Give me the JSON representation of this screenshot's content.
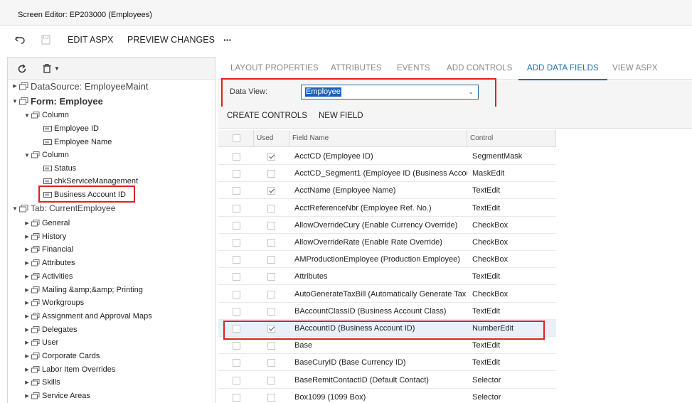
{
  "window": {
    "title": "Screen Editor: EP203000 (Employees)"
  },
  "toolbar": {
    "edit_aspx": "EDIT ASPX",
    "preview_changes": "PREVIEW CHANGES",
    "more": "···"
  },
  "tree": {
    "items": [
      {
        "label": "DataSource: EmployeeMaint",
        "level": 0,
        "expanded": false
      },
      {
        "label": "Form: Employee",
        "level": 0,
        "expanded": true,
        "bold": true
      },
      {
        "label": "Column",
        "level": 1,
        "expanded": true
      },
      {
        "label": "Employee ID",
        "level": 2
      },
      {
        "label": "Employee Name",
        "level": 2
      },
      {
        "label": "Column",
        "level": 1,
        "expanded": true
      },
      {
        "label": "Status",
        "level": 2
      },
      {
        "label": "chkServiceManagement",
        "level": 2
      },
      {
        "label": "Business Account ID",
        "level": 2,
        "highlighted": true
      },
      {
        "label": "Tab: CurrentEmployee",
        "level": 0,
        "expanded": true
      },
      {
        "label": "General",
        "level": 1,
        "expanded": false
      },
      {
        "label": "History",
        "level": 1,
        "expanded": false
      },
      {
        "label": "Financial",
        "level": 1,
        "expanded": false
      },
      {
        "label": "Attributes",
        "level": 1,
        "expanded": false
      },
      {
        "label": "Activities",
        "level": 1,
        "expanded": false
      },
      {
        "label": "Mailing &amp;&amp; Printing",
        "level": 1,
        "expanded": false
      },
      {
        "label": "Workgroups",
        "level": 1,
        "expanded": false
      },
      {
        "label": "Assignment and Approval Maps",
        "level": 1,
        "expanded": false
      },
      {
        "label": "Delegates",
        "level": 1,
        "expanded": false
      },
      {
        "label": "User",
        "level": 1,
        "expanded": false
      },
      {
        "label": "Corporate Cards",
        "level": 1,
        "expanded": false
      },
      {
        "label": "Labor Item Overrides",
        "level": 1,
        "expanded": false
      },
      {
        "label": "Skills",
        "level": 1,
        "expanded": false
      },
      {
        "label": "Service Areas",
        "level": 1,
        "expanded": false
      }
    ]
  },
  "tabs": [
    {
      "label": "LAYOUT PROPERTIES",
      "active": false
    },
    {
      "label": "ATTRIBUTES",
      "active": false
    },
    {
      "label": "EVENTS",
      "active": false
    },
    {
      "label": "ADD CONTROLS",
      "active": false
    },
    {
      "label": "ADD DATA FIELDS",
      "active": true
    },
    {
      "label": "VIEW ASPX",
      "active": false
    }
  ],
  "data_view": {
    "label": "Data View:",
    "value": "Employee"
  },
  "grid_toolbar": {
    "create_controls": "CREATE CONTROLS",
    "new_field": "NEW FIELD"
  },
  "grid": {
    "columns": {
      "used": "Used",
      "field_name": "Field Name",
      "control": "Control"
    },
    "rows": [
      {
        "used": true,
        "field": "AcctCD (Employee ID)",
        "control": "SegmentMask"
      },
      {
        "used": false,
        "field": "AcctCD_Segment1 (Employee ID (Business Accou",
        "control": "MaskEdit"
      },
      {
        "used": true,
        "field": "AcctName (Employee Name)",
        "control": "TextEdit"
      },
      {
        "used": false,
        "field": "AcctReferenceNbr (Employee Ref. No.)",
        "control": "TextEdit"
      },
      {
        "used": false,
        "field": "AllowOverrideCury (Enable Currency Override)",
        "control": "CheckBox"
      },
      {
        "used": false,
        "field": "AllowOverrideRate (Enable Rate Override)",
        "control": "CheckBox"
      },
      {
        "used": false,
        "field": "AMProductionEmployee (Production Employee)",
        "control": "CheckBox"
      },
      {
        "used": false,
        "field": "Attributes",
        "control": "TextEdit"
      },
      {
        "used": false,
        "field": "AutoGenerateTaxBill (Automatically Generate Tax I",
        "control": "CheckBox"
      },
      {
        "used": false,
        "field": "BAccountClassID (Business Account Class)",
        "control": "TextEdit"
      },
      {
        "used": true,
        "field": "BAccountID (Business Account ID)",
        "control": "NumberEdit",
        "selected": true
      },
      {
        "used": false,
        "field": "Base",
        "control": "TextEdit"
      },
      {
        "used": false,
        "field": "BaseCuryID (Base Currency ID)",
        "control": "TextEdit"
      },
      {
        "used": false,
        "field": "BaseRemitContactID (Default Contact)",
        "control": "Selector"
      },
      {
        "used": false,
        "field": "Box1099 (1099 Box)",
        "control": "Selector"
      }
    ]
  },
  "colors": {
    "accent": "#1d6fa8",
    "highlight_border": "#e02020",
    "selection": "#1a62b8"
  }
}
